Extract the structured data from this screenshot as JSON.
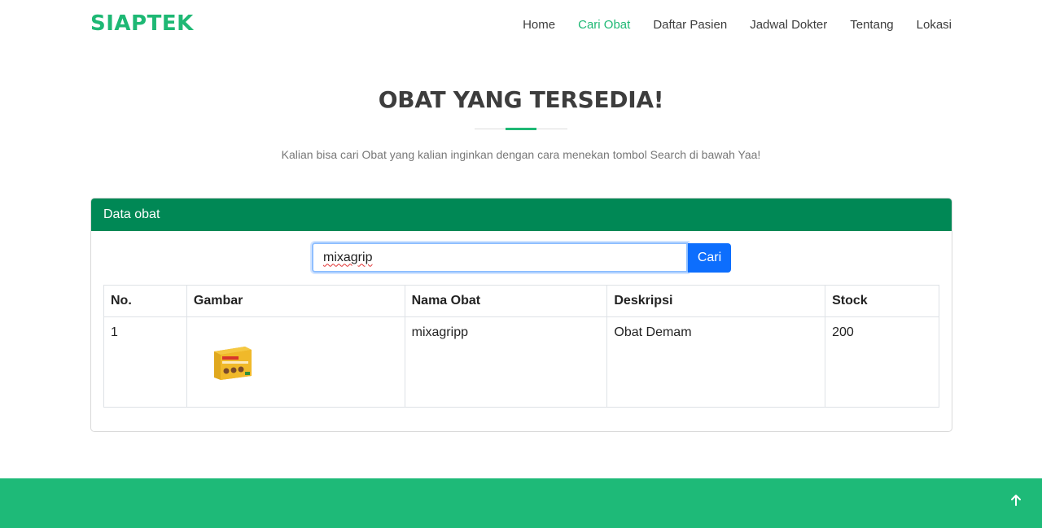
{
  "brand": {
    "name": "SIAPTEK"
  },
  "nav": {
    "items": [
      {
        "label": "Home"
      },
      {
        "label": "Cari Obat"
      },
      {
        "label": "Daftar Pasien"
      },
      {
        "label": "Jadwal Dokter"
      },
      {
        "label": "Tentang"
      },
      {
        "label": "Lokasi"
      }
    ],
    "active": "Cari Obat"
  },
  "section": {
    "title": "OBAT YANG TERSEDIA!",
    "subtitle": "Kalian bisa cari Obat yang kalian inginkan dengan cara menekan tombol Search di bawah Yaa!"
  },
  "card": {
    "header": "Data obat",
    "search": {
      "value": "mixagrip",
      "button_label": "Cari"
    },
    "table": {
      "columns": [
        "No.",
        "Gambar",
        "Nama Obat",
        "Deskripsi",
        "Stock"
      ],
      "rows": [
        {
          "no": "1",
          "image_icon": "medicine-box-image",
          "nama": "mixagripp",
          "deskripsi": "Obat Demam",
          "stock": "200"
        }
      ]
    }
  },
  "colors": {
    "brand": "#1eb874",
    "card_header": "#008855",
    "button": "#0d6efd",
    "footer": "#1eba78"
  },
  "icons": {
    "back_to_top": "arrow-up-icon"
  }
}
